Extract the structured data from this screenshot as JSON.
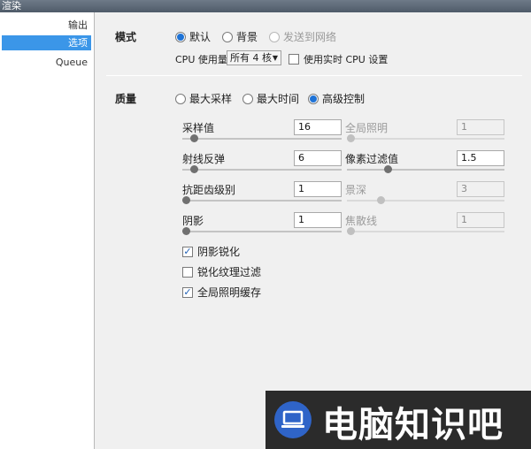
{
  "window": {
    "title": "渲染"
  },
  "sidebar": {
    "items": [
      {
        "label": "输出",
        "selected": false
      },
      {
        "label": "选项",
        "selected": true
      },
      {
        "label": "Queue",
        "selected": false
      }
    ]
  },
  "mode": {
    "label": "模式",
    "options": [
      {
        "label": "默认",
        "checked": true,
        "disabled": false
      },
      {
        "label": "背景",
        "checked": false,
        "disabled": false
      },
      {
        "label": "发送到网络",
        "checked": false,
        "disabled": true
      }
    ],
    "cpu_label": "CPU 使用量",
    "cpu_value": "所有 4 核",
    "realtime_cpu_label": "使用实时 CPU 设置",
    "realtime_cpu_checked": false
  },
  "quality": {
    "label": "质量",
    "options": [
      {
        "label": "最大采样",
        "checked": false
      },
      {
        "label": "最大时间",
        "checked": false
      },
      {
        "label": "高级控制",
        "checked": true
      }
    ],
    "params": {
      "samples": {
        "label": "采样值",
        "value": "16",
        "slider": 0.05
      },
      "gi": {
        "label": "全局照明",
        "value": "1",
        "slider": 0.0
      },
      "ray_bounces": {
        "label": "射线反弹",
        "value": "6",
        "slider": 0.05
      },
      "pixel_filter": {
        "label": "像素过滤值",
        "value": "1.5",
        "slider": 0.25
      },
      "antialias": {
        "label": "抗距齿级别",
        "value": "1",
        "slider": 0.0
      },
      "dof": {
        "label": "景深",
        "value": "3",
        "slider": 0.2
      },
      "shadow": {
        "label": "阴影",
        "value": "1",
        "slider": 0.0
      },
      "caustics": {
        "label": "焦散线",
        "value": "1",
        "slider": 0.0
      }
    },
    "checks": [
      {
        "label": "阴影锐化",
        "checked": true
      },
      {
        "label": "锐化纹理过滤",
        "checked": false
      },
      {
        "label": "全局照明缓存",
        "checked": true
      }
    ]
  },
  "watermark": {
    "text": "电脑知识吧",
    "icon": "laptop-icon"
  }
}
